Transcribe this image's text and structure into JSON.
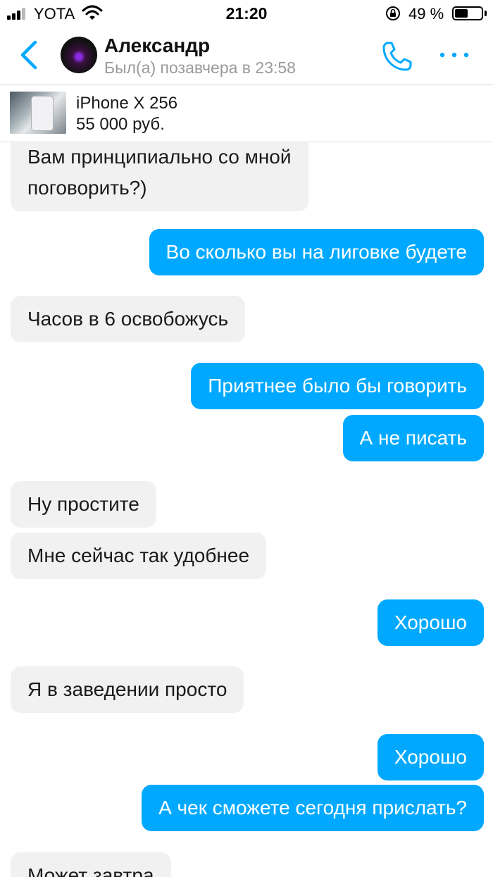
{
  "status_bar": {
    "carrier": "YOTA",
    "time": "21:20",
    "battery_percent": "49 %",
    "battery_level": 0.49
  },
  "header": {
    "contact_name": "Александр",
    "last_seen": "Был(а) позавчера в 23:58"
  },
  "listing": {
    "title": "iPhone X 256",
    "price": "55 000 руб."
  },
  "messages": [
    {
      "side": "incoming",
      "lines": [
        "Вам принципиально со мной",
        "поговорить?)"
      ]
    },
    {
      "side": "outgoing",
      "text": "Во сколько вы на лиговке будете"
    },
    {
      "side": "incoming",
      "text": "Часов в 6 освобожусь"
    },
    {
      "side": "outgoing",
      "text": "Приятнее было бы говорить"
    },
    {
      "side": "outgoing",
      "text": "А не писать"
    },
    {
      "side": "incoming",
      "text": "Ну простите"
    },
    {
      "side": "incoming",
      "text": "Мне сейчас так удобнее"
    },
    {
      "side": "outgoing",
      "text": "Хорошо"
    },
    {
      "side": "incoming",
      "text": "Я в заведении просто"
    },
    {
      "side": "outgoing",
      "text": "Хорошо"
    },
    {
      "side": "outgoing",
      "text": "А чек сможете сегодня прислать?"
    },
    {
      "side": "incoming",
      "text": "Может завтра"
    }
  ],
  "colors": {
    "accent": "#00a9ff",
    "incoming_bubble": "#f1f1f1",
    "secondary_text": "#9a9a9a"
  }
}
